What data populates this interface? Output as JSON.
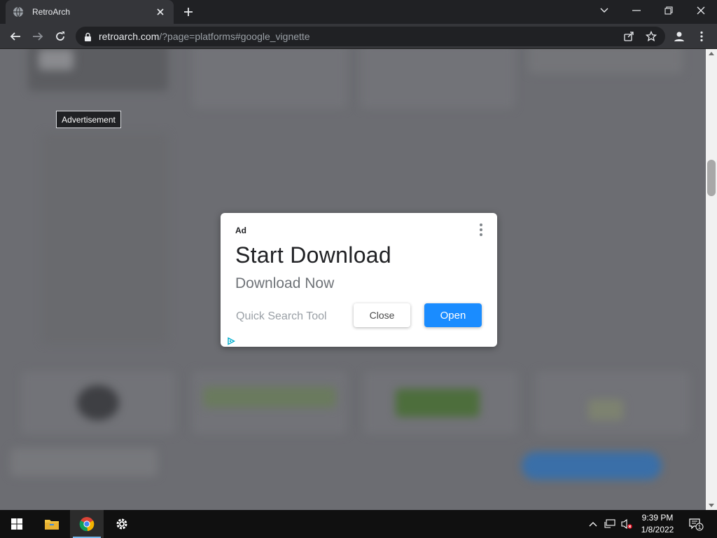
{
  "browser": {
    "tab_title": "RetroArch",
    "url_host": "retroarch.com",
    "url_rest": "/?page=platforms#google_vignette"
  },
  "page": {
    "advertisement_label": "Advertisement"
  },
  "ad": {
    "tag": "Ad",
    "headline": "Start Download",
    "subheadline": "Download Now",
    "advertiser": "Quick Search Tool",
    "close_label": "Close",
    "open_label": "Open",
    "open_color": "#1a8cff"
  },
  "taskbar": {
    "time": "9:39 PM",
    "date": "1/8/2022",
    "notification_count": "1"
  },
  "icons": [
    "globe-icon",
    "close-icon",
    "plus-icon",
    "chevron-down-icon",
    "minimize-icon",
    "restore-icon",
    "back-icon",
    "forward-icon",
    "reload-icon",
    "lock-icon",
    "share-icon",
    "star-icon",
    "profile-icon",
    "kebab-icon",
    "adchoices-icon",
    "windows-start-icon",
    "file-explorer-icon",
    "chrome-icon",
    "settings-icon",
    "chevron-up-icon",
    "network-icon",
    "volume-muted-icon",
    "notification-icon"
  ]
}
